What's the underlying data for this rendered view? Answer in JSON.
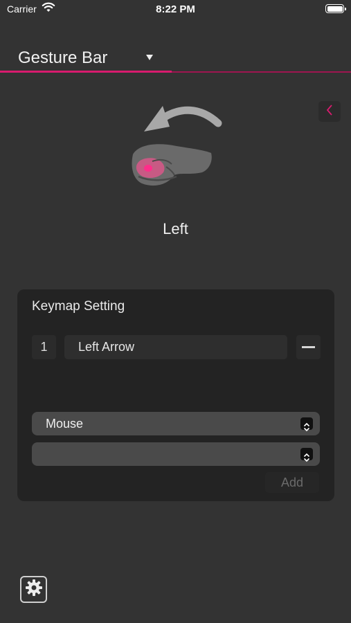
{
  "status_bar": {
    "carrier": "Carrier",
    "time": "8:22 PM"
  },
  "header": {
    "title": "Gesture Bar",
    "dropdown_icon": "triangle-down-icon"
  },
  "colors": {
    "accent": "#d81b6e",
    "background": "#333333",
    "panel": "#232323"
  },
  "gesture": {
    "label": "Left",
    "illustration_icon": "hand-swipe-left-icon",
    "back_icon": "chevron-left-icon"
  },
  "keymap": {
    "title": "Keymap Setting",
    "rows": [
      {
        "index": "1",
        "key": "Left Arrow"
      }
    ],
    "type_select": {
      "value": "Mouse"
    },
    "key_select": {
      "value": ""
    },
    "add_label": "Add"
  },
  "footer": {
    "settings_icon": "gear-icon"
  }
}
